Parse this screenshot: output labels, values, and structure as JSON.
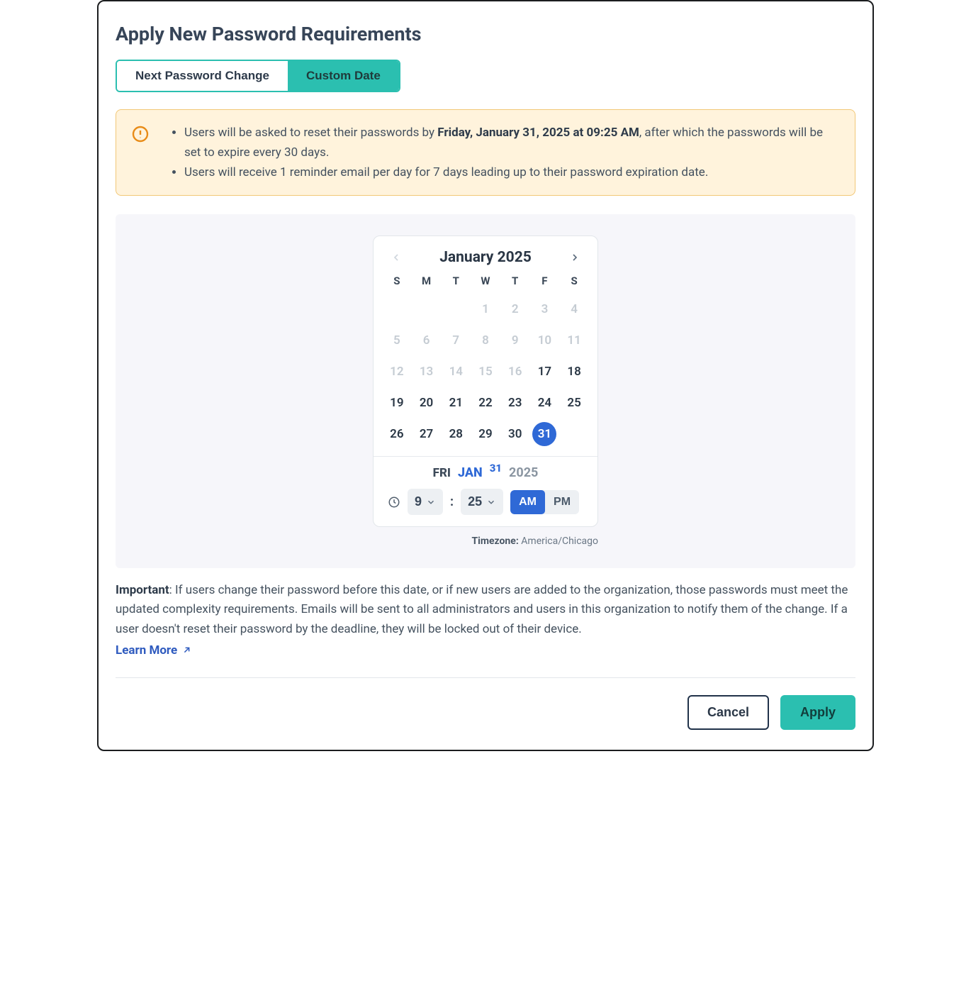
{
  "title": "Apply New Password Requirements",
  "tabs": {
    "next": "Next Password Change",
    "custom": "Custom Date"
  },
  "alert": {
    "bullet1_pre": "Users will be asked to reset their passwords by ",
    "bullet1_strong": "Friday, January 31, 2025 at 09:25 AM",
    "bullet1_post": ", after which the passwords will be set to expire every 30 days.",
    "bullet2": "Users will receive 1 reminder email per day for 7 days leading up to their password expiration date."
  },
  "calendar": {
    "title": "January 2025",
    "dow": [
      "S",
      "M",
      "T",
      "W",
      "T",
      "F",
      "S"
    ],
    "days": [
      {
        "n": "",
        "state": "empty"
      },
      {
        "n": "",
        "state": "empty"
      },
      {
        "n": "",
        "state": "empty"
      },
      {
        "n": "1",
        "state": "disabled"
      },
      {
        "n": "2",
        "state": "disabled"
      },
      {
        "n": "3",
        "state": "disabled"
      },
      {
        "n": "4",
        "state": "disabled"
      },
      {
        "n": "5",
        "state": "disabled"
      },
      {
        "n": "6",
        "state": "disabled"
      },
      {
        "n": "7",
        "state": "disabled"
      },
      {
        "n": "8",
        "state": "disabled"
      },
      {
        "n": "9",
        "state": "disabled"
      },
      {
        "n": "10",
        "state": "disabled"
      },
      {
        "n": "11",
        "state": "disabled"
      },
      {
        "n": "12",
        "state": "disabled"
      },
      {
        "n": "13",
        "state": "disabled"
      },
      {
        "n": "14",
        "state": "disabled"
      },
      {
        "n": "15",
        "state": "disabled"
      },
      {
        "n": "16",
        "state": "disabled"
      },
      {
        "n": "17",
        "state": "enabled"
      },
      {
        "n": "18",
        "state": "enabled"
      },
      {
        "n": "19",
        "state": "enabled"
      },
      {
        "n": "20",
        "state": "enabled"
      },
      {
        "n": "21",
        "state": "enabled"
      },
      {
        "n": "22",
        "state": "enabled"
      },
      {
        "n": "23",
        "state": "enabled"
      },
      {
        "n": "24",
        "state": "enabled"
      },
      {
        "n": "25",
        "state": "enabled"
      },
      {
        "n": "26",
        "state": "enabled"
      },
      {
        "n": "27",
        "state": "enabled"
      },
      {
        "n": "28",
        "state": "enabled"
      },
      {
        "n": "29",
        "state": "enabled"
      },
      {
        "n": "30",
        "state": "enabled"
      },
      {
        "n": "31",
        "state": "selected"
      }
    ],
    "selected_dow": "FRI",
    "selected_mon": "JAN",
    "selected_day": "31",
    "selected_year": "2025",
    "hour": "9",
    "minute": "25",
    "am": "AM",
    "pm": "PM",
    "tz_label": "Timezone: ",
    "tz_value": "America/Chicago"
  },
  "important_label": "Important",
  "important_text": ": If users change their password before this date, or if new users are added to the organization, those passwords must meet the updated complexity requirements. Emails will be sent to all administrators and users in this organization to notify them of the change. If a user doesn't reset their password by the deadline, they will be locked out of their device.",
  "learn_more": "Learn More",
  "buttons": {
    "cancel": "Cancel",
    "apply": "Apply"
  }
}
